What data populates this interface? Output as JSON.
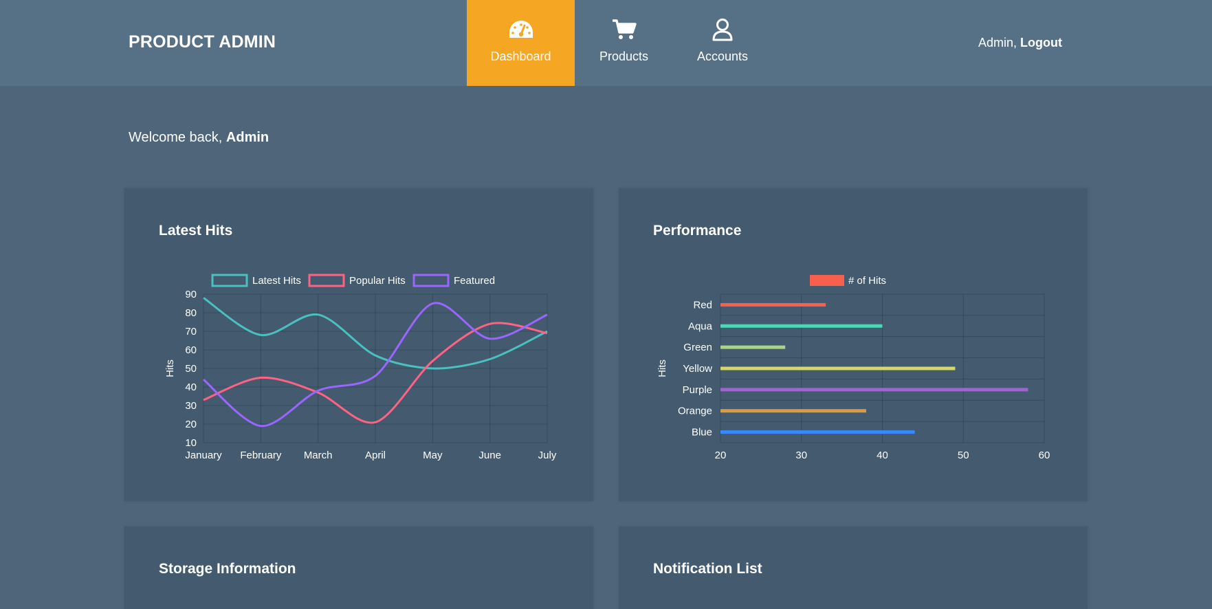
{
  "header": {
    "brand": "PRODUCT ADMIN",
    "nav": [
      {
        "label": "Dashboard",
        "icon": "speedometer-icon",
        "active": true
      },
      {
        "label": "Products",
        "icon": "cart-icon",
        "active": false
      },
      {
        "label": "Accounts",
        "icon": "user-icon",
        "active": false
      }
    ],
    "user_name": "Admin,",
    "logout_label": "Logout",
    "accent_color": "#f5a623"
  },
  "welcome": {
    "prefix": "Welcome back,",
    "name": "Admin"
  },
  "panels": {
    "latest_hits": {
      "title": "Latest Hits"
    },
    "performance": {
      "title": "Performance"
    },
    "storage": {
      "title": "Storage Information"
    },
    "notifications": {
      "title": "Notification List"
    }
  },
  "chart_data": [
    {
      "type": "line",
      "title": "",
      "xlabel": "",
      "ylabel": "Hits",
      "categories": [
        "January",
        "February",
        "March",
        "April",
        "May",
        "June",
        "July"
      ],
      "ylim": [
        10,
        90
      ],
      "yticks": [
        10,
        20,
        30,
        40,
        50,
        60,
        70,
        80,
        90
      ],
      "grid": true,
      "legend": "top",
      "series": [
        {
          "name": "Latest Hits",
          "color": "#4bc0c0",
          "values": [
            88,
            68,
            79,
            57,
            50,
            55,
            70
          ]
        },
        {
          "name": "Popular Hits",
          "color": "#ff6384",
          "values": [
            33,
            45,
            37,
            21,
            54,
            74,
            69
          ]
        },
        {
          "name": "Featured",
          "color": "#9966ff",
          "values": [
            44,
            19,
            38,
            46,
            85,
            66,
            79
          ]
        }
      ]
    },
    {
      "type": "bar",
      "orientation": "horizontal",
      "title": "",
      "xlabel": "",
      "ylabel": "Hits",
      "categories": [
        "Red",
        "Aqua",
        "Green",
        "Yellow",
        "Purple",
        "Orange",
        "Blue"
      ],
      "xlim": [
        20,
        60
      ],
      "xticks": [
        20,
        30,
        40,
        50,
        60
      ],
      "grid": true,
      "legend": "top",
      "series": [
        {
          "name": "# of Hits",
          "color": "#f7604d",
          "values": [
            33,
            40,
            28,
            49,
            58,
            38,
            44
          ]
        }
      ],
      "bar_colors": [
        "#f7604d",
        "#4ed6b8",
        "#a8d582",
        "#d7d768",
        "#9d66cc",
        "#db9c3f",
        "#3889fc"
      ]
    }
  ]
}
